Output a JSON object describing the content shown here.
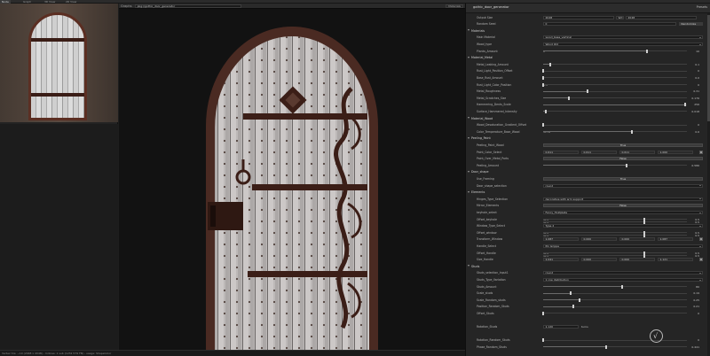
{
  "topbar": {
    "tabs": [
      {
        "label": "Node",
        "active": true
      },
      {
        "label": "Graph",
        "active": false
      },
      {
        "label": "3D View",
        "active": false
      },
      {
        "label": "2D View",
        "active": false
      }
    ]
  },
  "viewport": {
    "graph_label": "Graphs",
    "graph_select": "pkg://gothic_door_generator",
    "mode_label": "Materials"
  },
  "panel": {
    "title": "gothic_door_generator",
    "presets_label": "Presets",
    "colors": {
      "accent": "#cfcfcf",
      "panel_bg": "#252525",
      "rust": "#5b2e22"
    },
    "rows": [
      {
        "type": "size",
        "label": "Output Size",
        "a": "2048",
        "link": "Wd",
        "b": "2048"
      },
      {
        "type": "seed",
        "label": "Random Seed",
        "value": "0",
        "button": "Randomize"
      },
      {
        "type": "section",
        "label": "Materials"
      },
      {
        "type": "dropdown",
        "label": "Main Material",
        "value": "wood_base_vertical"
      },
      {
        "type": "dropdown",
        "label": "Wood_type",
        "value": "Wood Old"
      },
      {
        "type": "slider",
        "label": "Planks_Amount",
        "left": "1",
        "value": "10",
        "pos": 0.72
      },
      {
        "type": "section",
        "label": "Material_Metal"
      },
      {
        "type": "slider",
        "label": "Metal_Leaking_Amount",
        "value": "0.1",
        "pos": 0.05
      },
      {
        "type": "slider",
        "label": "Rust_Light_Position_Offset",
        "value": "0",
        "pos": 0.0
      },
      {
        "type": "slider",
        "label": "Base_Rust_Amount",
        "value": "0.0",
        "pos": 0.0
      },
      {
        "type": "slider",
        "label": "Rust_Light_Color_Position",
        "left": "0.3",
        "value": "0",
        "pos": 0.0
      },
      {
        "type": "slider",
        "label": "Metal_Roughness",
        "value": "0.31",
        "pos": 0.31
      },
      {
        "type": "slider",
        "label": "Metal_Scratches_Size",
        "value": "0.176",
        "pos": 0.18
      },
      {
        "type": "slider",
        "label": "Hammering_Dents_Scale",
        "value": "256",
        "pos": 0.99
      },
      {
        "type": "slider",
        "label": "Surface_Hammered_Intensity",
        "value": "0.018",
        "pos": 0.02
      },
      {
        "type": "section",
        "label": "Material_Wood"
      },
      {
        "type": "slider",
        "label": "Wood_Desaturation_Gradient_Offset",
        "value": "0",
        "pos": 0.0
      },
      {
        "type": "slider",
        "label": "Color_Temperature_Base_Wood",
        "left": "-0.76",
        "value": "0.6",
        "pos": 0.62
      },
      {
        "type": "section",
        "label": "Peeling_Paint"
      },
      {
        "type": "button",
        "label": "Peeling_Paint_Wood",
        "value": "True"
      },
      {
        "type": "color",
        "label": "Paint_Color_Select",
        "c1": "0.611",
        "c2": "0.611",
        "c3": "0.611",
        "c4": "1.000"
      },
      {
        "type": "button",
        "label": "Paint_Over_Metal_Parts",
        "value": "False"
      },
      {
        "type": "slider",
        "label": "Peeling_Amount",
        "value": "0.586",
        "pos": 0.58
      },
      {
        "type": "section",
        "label": "Door_shape"
      },
      {
        "type": "button",
        "label": "Use_Framing",
        "value": "True"
      },
      {
        "type": "dropdown",
        "label": "Door_shape_selection",
        "value": "round"
      },
      {
        "type": "section",
        "label": "Elements"
      },
      {
        "type": "dropdown",
        "label": "Hinges_Type_Selection",
        "value": "decorative with arm support"
      },
      {
        "type": "button",
        "label": "Mirror_Elements",
        "value": "False"
      },
      {
        "type": "dropdown",
        "label": "keyhole_select",
        "value": "Fancy_Holdplate"
      },
      {
        "type": "xy",
        "label": "Offset_keyhole",
        "x": "-0.3",
        "xv": "0.5",
        "y": "-0.3",
        "yv": "0.5"
      },
      {
        "type": "dropdown",
        "label": "Window_Type_Select",
        "value": "Type 2"
      },
      {
        "type": "xy",
        "label": "Offset_window",
        "x": "-0.5",
        "xv": "0.5",
        "y": "-0.3",
        "yv": "0.5"
      },
      {
        "type": "color",
        "label": "Transform_Window",
        "c1": "1.087",
        "c2": "0.000",
        "c3": "0.000",
        "c4": "1.087"
      },
      {
        "type": "dropdown",
        "label": "Handle_Select",
        "value": "Pin Grippe"
      },
      {
        "type": "xy",
        "label": "Offset_Handle",
        "x": "-0.5",
        "xv": "0.5",
        "y": "-0.3",
        "yv": "0.5"
      },
      {
        "type": "color",
        "label": "Size_Handle",
        "c1": "1.041",
        "c2": "0.000",
        "c3": "0.000",
        "c4": "1.121"
      },
      {
        "type": "section",
        "label": "Studs"
      },
      {
        "type": "dropdown",
        "label": "Studs_selection_Input1",
        "value": "round"
      },
      {
        "type": "dropdown",
        "label": "Studs_Type_Variation",
        "value": "1 row distribution"
      },
      {
        "type": "slider",
        "label": "Studs_Amount",
        "value": "80",
        "pos": 0.55
      },
      {
        "type": "slider",
        "label": "Scale_studs",
        "value": "0.19",
        "pos": 0.19
      },
      {
        "type": "slider",
        "label": "Scale_Random_studs",
        "value": "0.25",
        "pos": 0.25
      },
      {
        "type": "slider",
        "label": "Position_Random_Studs",
        "value": "0.21",
        "pos": 0.21
      },
      {
        "type": "slider",
        "label": "Offset_Studs",
        "value": "0",
        "pos": 0.0
      },
      {
        "type": "blank",
        "label": ""
      },
      {
        "type": "rot",
        "label": "Rotation_Studs",
        "value": "1.120",
        "unit": "turns"
      },
      {
        "type": "blank",
        "label": ""
      },
      {
        "type": "slider",
        "label": "Rotation_Random_Studs",
        "value": "0",
        "pos": 0.0
      },
      {
        "type": "slider",
        "label": "Phase_Random_Studs",
        "value": "0.441",
        "pos": 0.44
      }
    ]
  },
  "statusbar": {
    "text": "Vertex tris: ~10 (2048 x 2048) - Indices: 1 sub (1232 579 FB) - usage: ShapeColor"
  }
}
